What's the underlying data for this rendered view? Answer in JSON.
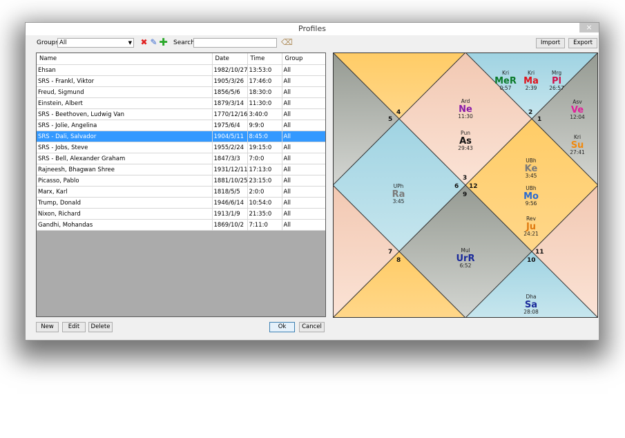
{
  "window": {
    "title": "Profiles",
    "close": "×"
  },
  "toolbar": {
    "groups_label": "Groups:",
    "groups_value": "All",
    "delete_icon": "delete-icon",
    "edit_icon": "pencil-icon",
    "add_icon": "add-icon",
    "search_label": "Search:",
    "search_value": "",
    "clear_icon": "eraser-icon",
    "import_label": "Import",
    "export_label": "Export"
  },
  "table": {
    "columns": [
      "Name",
      "Date",
      "Time",
      "Group"
    ],
    "rows": [
      [
        "Ehsan",
        "1982/10/27",
        "13:53:0",
        "All"
      ],
      [
        "SRS - Frankl, Viktor",
        "1905/3/26",
        "17:46:0",
        "All"
      ],
      [
        " Freud, Sigmund",
        "1856/5/6",
        "18:30:0",
        "All"
      ],
      [
        " Einstein, Albert",
        "1879/3/14",
        "11:30:0",
        "All"
      ],
      [
        "SRS - Beethoven, Ludwig Van",
        "1770/12/16",
        "3:40:0",
        "All"
      ],
      [
        "SRS - Jolie, Angelina",
        "1975/6/4",
        "9:9:0",
        "All"
      ],
      [
        "SRS - Dali, Salvador",
        "1904/5/11",
        "8:45:0",
        "All"
      ],
      [
        "SRS - Jobs, Steve",
        "1955/2/24",
        "19:15:0",
        "All"
      ],
      [
        "SRS - Bell, Alexander Graham",
        "1847/3/3",
        "7:0:0",
        "All"
      ],
      [
        " Rajneesh, Bhagwan Shree",
        "1931/12/11",
        "17:13:0",
        "All"
      ],
      [
        "Picasso, Pablo",
        "1881/10/25",
        "23:15:0",
        "All"
      ],
      [
        "Marx, Karl",
        "1818/5/5",
        "2:0:0",
        "All"
      ],
      [
        " Trump, Donald",
        "1946/6/14",
        "10:54:0",
        "All"
      ],
      [
        "Nixon, Richard",
        "1913/1/9",
        "21:35:0",
        "All"
      ],
      [
        "Gandhi, Mohandas",
        "1869/10/2",
        "7:11:0",
        "All"
      ]
    ],
    "selected_index": 6
  },
  "buttons": {
    "new": "New",
    "edit": "Edit",
    "delete": "Delete",
    "ok": "Ok",
    "cancel": "Cancel"
  },
  "chart": {
    "house_numbers": [
      "1",
      "2",
      "3",
      "4",
      "5",
      "6",
      "7",
      "8",
      "9",
      "10",
      "11",
      "12"
    ],
    "planets": [
      {
        "prefix": "Kri",
        "abbr": "MeR",
        "degree": "0:57",
        "color": "#0a7a2a"
      },
      {
        "prefix": "Kri",
        "abbr": "Ma",
        "degree": "2:39",
        "color": "#e0101a"
      },
      {
        "prefix": "Mrg",
        "abbr": "Pl",
        "degree": "26:57",
        "color": "#d0104a"
      },
      {
        "prefix": "Asv",
        "abbr": "Ve",
        "degree": "12:04",
        "color": "#e0209a"
      },
      {
        "prefix": "Kri",
        "abbr": "Su",
        "degree": "27:41",
        "color": "#f08a10"
      },
      {
        "prefix": "Ard",
        "abbr": "Ne",
        "degree": "11:30",
        "color": "#8a1aa8"
      },
      {
        "prefix": "Pun",
        "abbr": "As",
        "degree": "29:43",
        "color": "#111111"
      },
      {
        "prefix": "UBh",
        "abbr": "Ke",
        "degree": "3:45",
        "color": "#7a7a7a"
      },
      {
        "prefix": "UBh",
        "abbr": "Mo",
        "degree": "9:56",
        "color": "#2a6ad0"
      },
      {
        "prefix": "Rev",
        "abbr": "Ju",
        "degree": "24:21",
        "color": "#e07a10"
      },
      {
        "prefix": "UPh",
        "abbr": "Ra",
        "degree": "3:45",
        "color": "#7a7a7a"
      },
      {
        "prefix": "Mul",
        "abbr": "UrR",
        "degree": "6:52",
        "color": "#1a2a9a"
      },
      {
        "prefix": "Dha",
        "abbr": "Sa",
        "degree": "28:08",
        "color": "#1a2a9a"
      }
    ]
  }
}
